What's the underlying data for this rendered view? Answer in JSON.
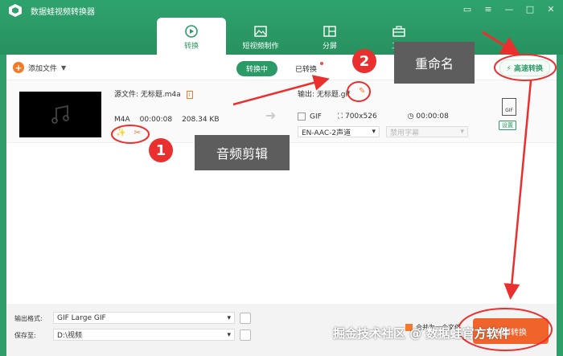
{
  "app": {
    "title": "数据蛙视频转换器"
  },
  "tabs": [
    {
      "label": "转换"
    },
    {
      "label": "短视频制作"
    },
    {
      "label": "分屏"
    },
    {
      "label": "工具"
    }
  ],
  "toolbar": {
    "add_file": "添加文件",
    "converting": "转换中",
    "converted": "已转换",
    "turbo": "高速转换"
  },
  "file": {
    "source_name": "源文件: 无标题.m4a",
    "source_format": "M4A",
    "source_duration": "00:00:08",
    "source_size": "208.34 KB",
    "output_name": "输出: 无标题.gif",
    "output_format": "GIF",
    "output_resolution": "700x526",
    "output_duration": "00:00:08",
    "audio_track": "EN-AAC-2声道",
    "subtitle": "禁用字幕",
    "format_icon_label": "GIF",
    "settings": "设置"
  },
  "bottom": {
    "output_format_label": "输出格式:",
    "output_format_value": "GIF Large GIF",
    "save_to_label": "保存至:",
    "save_to_value": "D:\\视频",
    "merge_label": "合并为一个文件",
    "convert_all": "全部转换"
  },
  "annotations": {
    "badge1": "1",
    "label1": "音频剪辑",
    "badge2": "2",
    "label2": "重命名"
  },
  "watermark": "掘金技术社区 @ 数据蛙官方软件",
  "colors": {
    "brand": "#2b9a66",
    "accent": "#f0632a",
    "annotation_red": "#ea2f2f"
  }
}
